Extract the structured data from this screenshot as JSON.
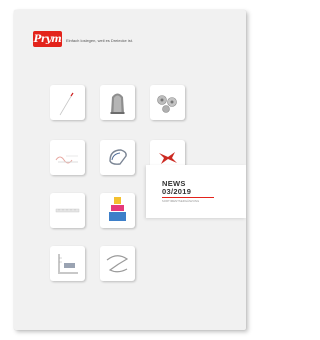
{
  "brand": {
    "logo_text": "Prym",
    "tagline": "Einfach loslegen, weil es Dreiecke ist.",
    "color": "#e3231b"
  },
  "tiles": [
    {
      "icon": "needle-icon"
    },
    {
      "icon": "thimble-icon"
    },
    {
      "icon": "snap-fasteners-icon"
    },
    {
      "icon": "loop-turner-icon"
    },
    {
      "icon": "iron-on-icon"
    },
    {
      "icon": "red-ribbon-icon"
    },
    {
      "icon": "ruler-icon"
    },
    {
      "icon": "thread-spools-icon"
    },
    {
      "icon": "measuring-gauge-icon"
    },
    {
      "icon": "cord-icon"
    }
  ],
  "news": {
    "title": "NEWS",
    "issue": "03/2019",
    "subtitle": "SORTIMENTSERGÄNZUNG"
  }
}
